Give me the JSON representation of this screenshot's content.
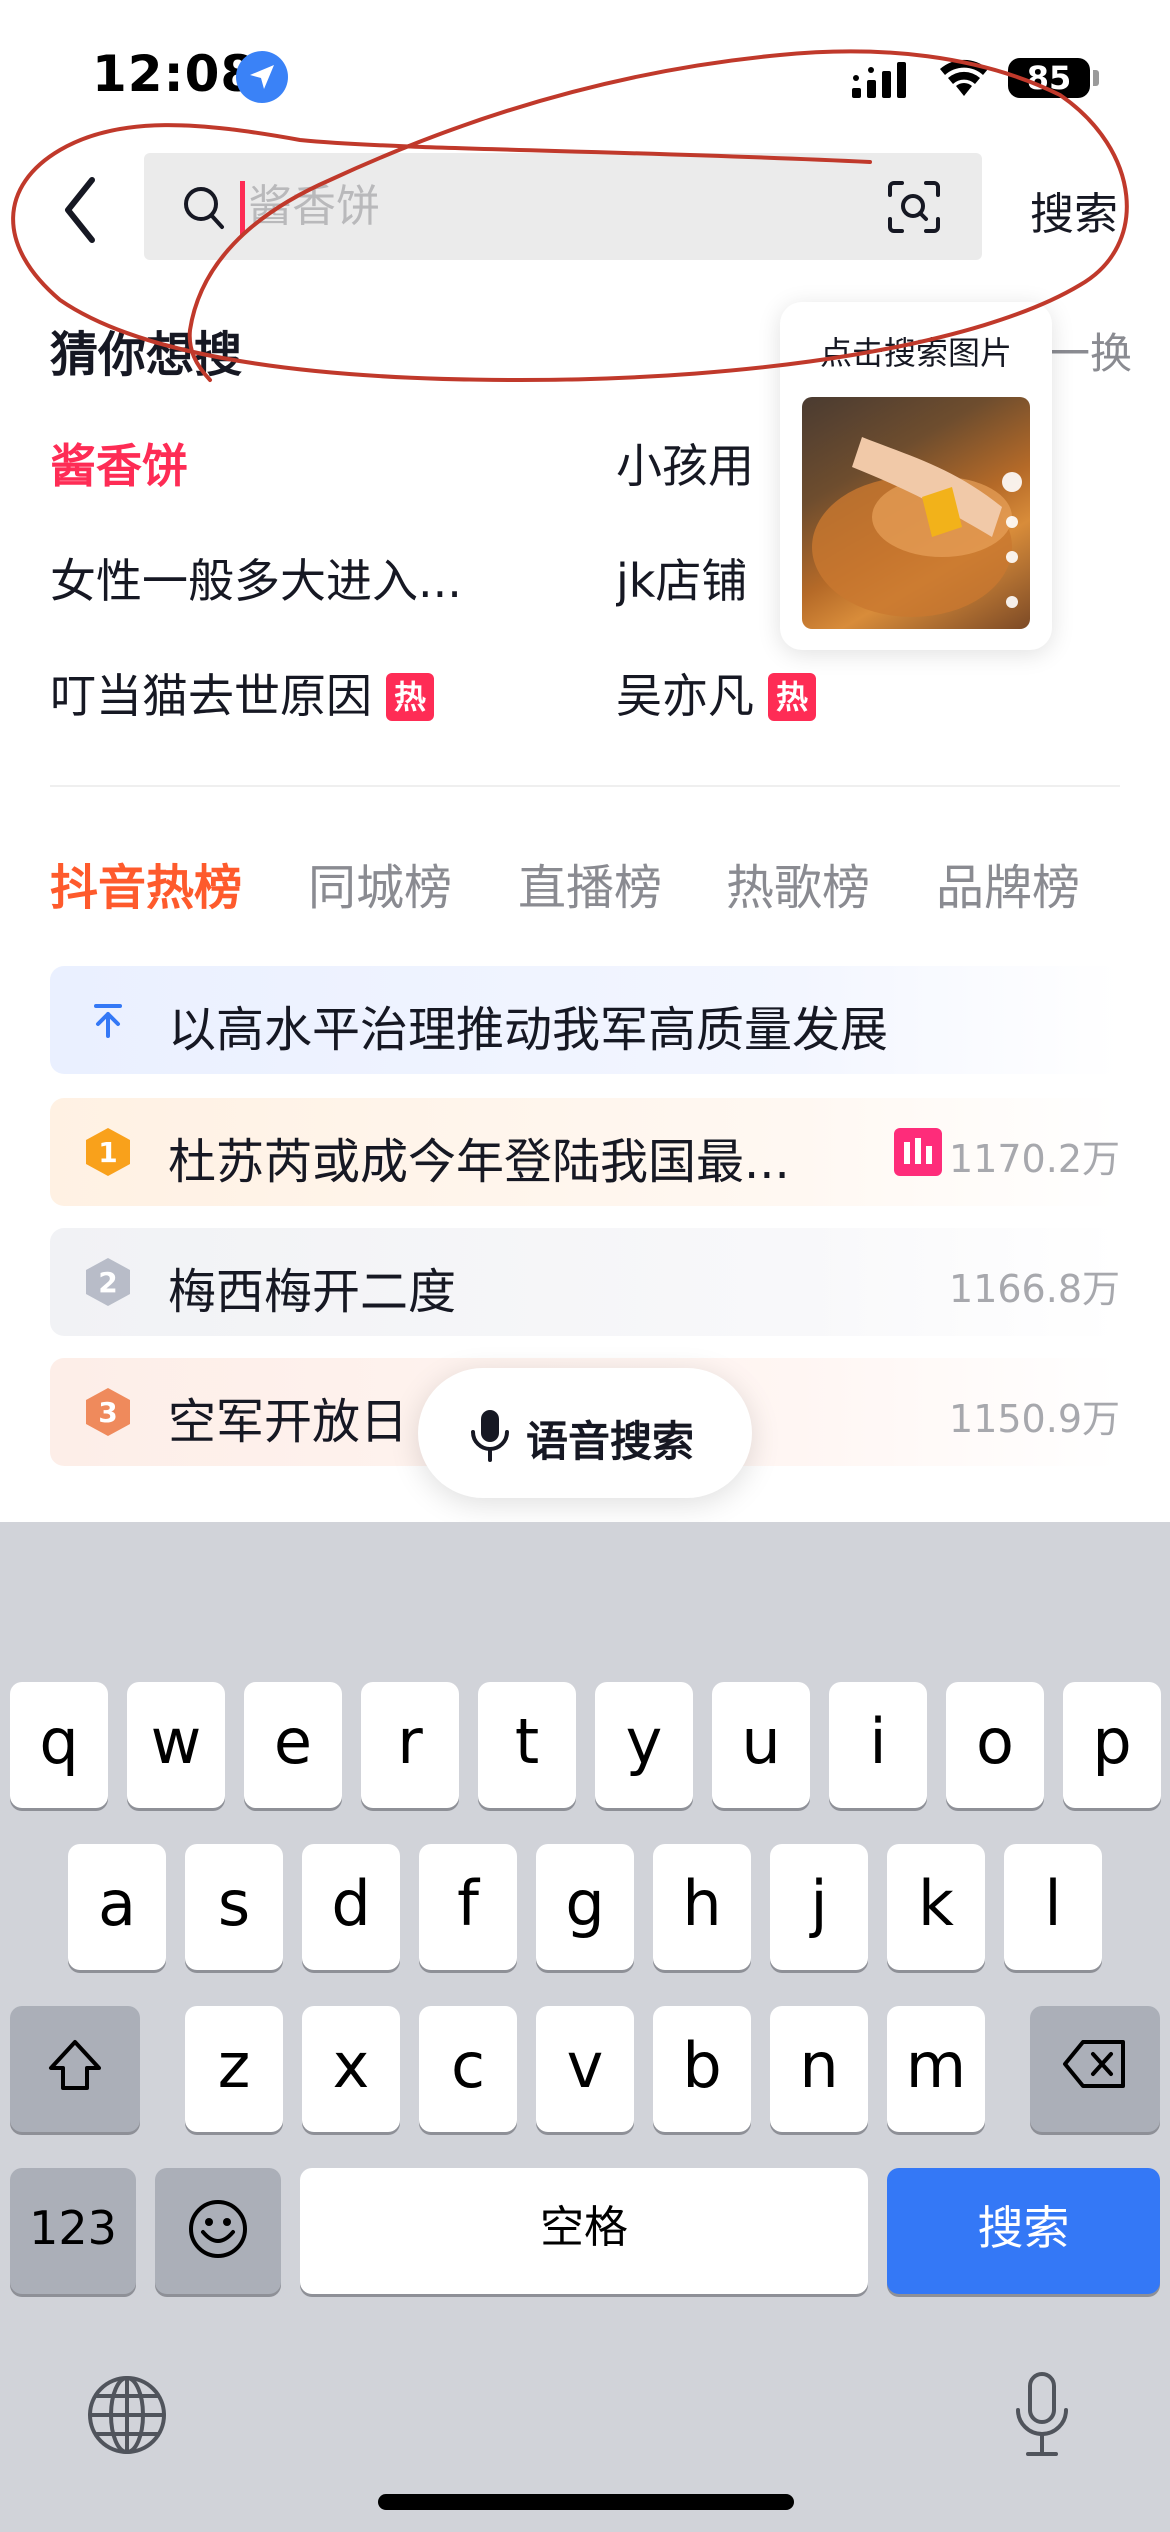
{
  "status_bar": {
    "time": "12:08",
    "battery": "85"
  },
  "search": {
    "placeholder": "酱香饼",
    "submit_label": "搜索"
  },
  "guess": {
    "title": "猜你想搜",
    "refresh_label": "一换",
    "suggestions": [
      {
        "text": "酱香饼",
        "highlight": true,
        "hot": false
      },
      {
        "text": "小孩用",
        "highlight": false,
        "hot": false
      },
      {
        "text": "女性一般多大进入...",
        "highlight": false,
        "hot": false
      },
      {
        "text": "jk店铺",
        "highlight": false,
        "hot": false
      },
      {
        "text": "叮当猫去世原因",
        "highlight": false,
        "hot": true
      },
      {
        "text": "吴亦凡",
        "highlight": false,
        "hot": true
      }
    ],
    "hot_badge": "热"
  },
  "image_popup": {
    "label": "点击搜索图片"
  },
  "tabs": [
    "抖音热榜",
    "同城榜",
    "直播榜",
    "热歌榜",
    "品牌榜"
  ],
  "hot_list": [
    {
      "rank": "pinned",
      "text": "以高水平治理推动我军高质量发展",
      "count": ""
    },
    {
      "rank": "1",
      "text": "杜苏芮或成今年登陆我国最...",
      "count": "1170.2万",
      "live": true
    },
    {
      "rank": "2",
      "text": "梅西梅开二度",
      "count": "1166.8万"
    },
    {
      "rank": "3",
      "text": "空军开放日",
      "count": "1150.9万"
    }
  ],
  "voice_search": {
    "label": "语音搜索"
  },
  "keyboard": {
    "row1": [
      "q",
      "w",
      "e",
      "r",
      "t",
      "y",
      "u",
      "i",
      "o",
      "p"
    ],
    "row2": [
      "a",
      "s",
      "d",
      "f",
      "g",
      "h",
      "j",
      "k",
      "l"
    ],
    "row3": [
      "z",
      "x",
      "c",
      "v",
      "b",
      "n",
      "m"
    ],
    "numbers_label": "123",
    "space_label": "空格",
    "go_label": "搜索"
  },
  "colors": {
    "accent_red": "#fe2c55",
    "hot_tab": "#fe5a2c",
    "keyboard_go": "#3478f6",
    "annotation": "#c0392b"
  }
}
